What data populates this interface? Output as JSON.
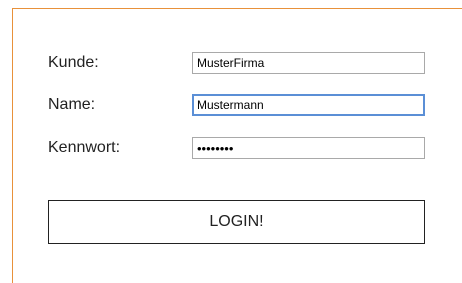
{
  "form": {
    "customer": {
      "label": "Kunde:",
      "value": "MusterFirma"
    },
    "name": {
      "label": "Name:",
      "value": "Mustermann"
    },
    "password": {
      "label": "Kennwort:",
      "value": "12345678"
    },
    "submit_label": "LOGIN!"
  },
  "colors": {
    "panel_border": "#e8913a",
    "focus_border": "#5b8fd6",
    "field_border": "#a9a9a9"
  }
}
